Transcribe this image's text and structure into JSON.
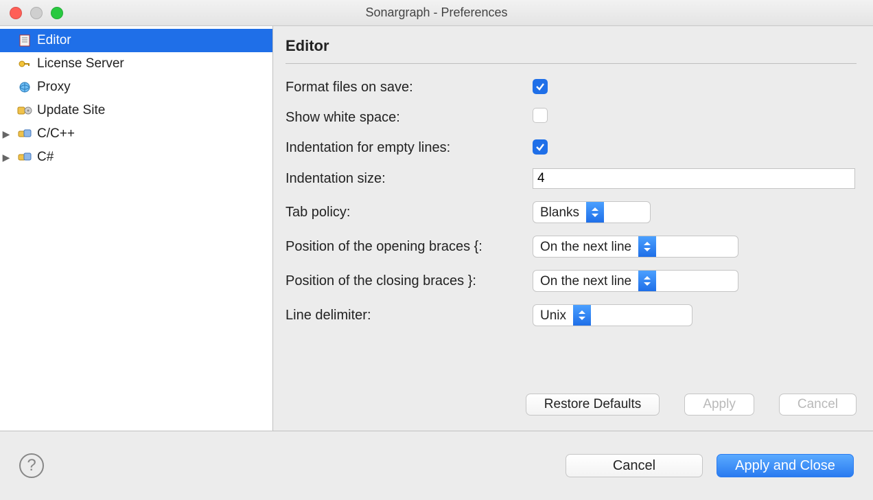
{
  "window_title": "Sonargraph - Preferences",
  "sidebar": {
    "items": [
      {
        "label": "Editor",
        "selected": true,
        "expandable": false
      },
      {
        "label": "License Server",
        "selected": false,
        "expandable": false
      },
      {
        "label": "Proxy",
        "selected": false,
        "expandable": false
      },
      {
        "label": "Update Site",
        "selected": false,
        "expandable": false
      },
      {
        "label": "C/C++",
        "selected": false,
        "expandable": true
      },
      {
        "label": "C#",
        "selected": false,
        "expandable": true
      }
    ]
  },
  "panel": {
    "title": "Editor",
    "rows": {
      "format_on_save": {
        "label": "Format files on save:",
        "checked": true
      },
      "show_whitespace": {
        "label": "Show white space:",
        "checked": false
      },
      "indent_empty": {
        "label": "Indentation for empty lines:",
        "checked": true
      },
      "indent_size": {
        "label": "Indentation size:",
        "value": "4"
      },
      "tab_policy": {
        "label": "Tab policy:",
        "value": "Blanks"
      },
      "open_braces": {
        "label": "Position of the opening braces {:",
        "value": "On the next line"
      },
      "close_braces": {
        "label": "Position of the closing braces }:",
        "value": "On the next line"
      },
      "line_delim": {
        "label": "Line delimiter:",
        "value": "Unix"
      }
    },
    "buttons": {
      "restore": "Restore Defaults",
      "apply": "Apply",
      "cancel": "Cancel"
    }
  },
  "footer": {
    "cancel": "Cancel",
    "apply_close": "Apply and Close"
  }
}
